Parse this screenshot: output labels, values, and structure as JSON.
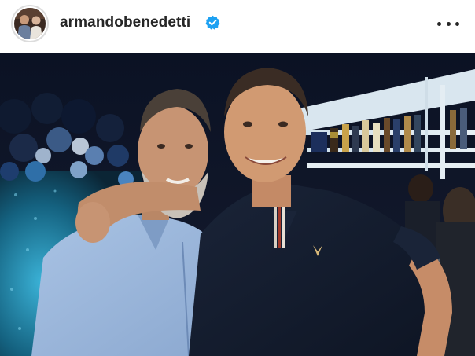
{
  "post": {
    "username": "armandobenedetti",
    "verified": true,
    "avatar_icon": "profile-avatar",
    "more_icon": "more-horizontal-icon",
    "verified_icon": "verified-badge-icon",
    "photo": "photo-two-men-at-bar-night",
    "accent_color": "#1da1f2"
  }
}
